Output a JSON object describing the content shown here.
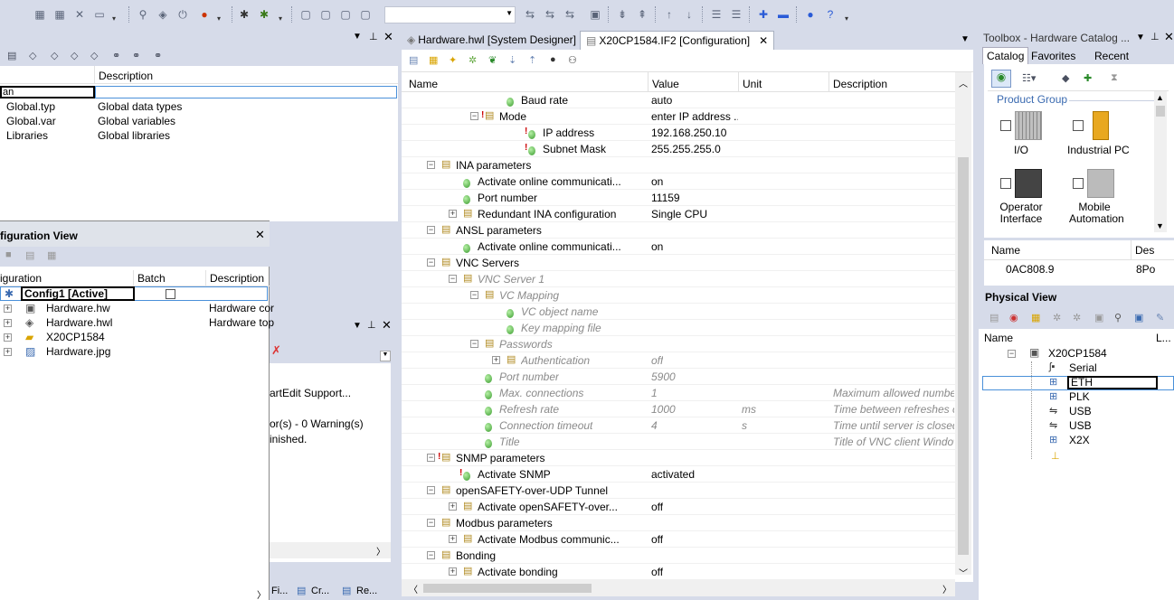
{
  "toolbar": {
    "icons": [
      "new-icon",
      "open-icon",
      "delete-icon",
      "save-icon",
      "find-icon",
      "build-icon",
      "power-icon",
      "traffic-light-icon",
      "debug-icon",
      "bug-icon",
      "window-icon",
      "find-replace-icon",
      "indent-icon",
      "arrow-up-icon",
      "arrow-down-icon",
      "list-icon",
      "help-icon"
    ]
  },
  "left_top": {
    "col_description": "Description",
    "edit_value": "an",
    "rows": [
      {
        "name": "Global.typ",
        "desc": "Global data types"
      },
      {
        "name": "Global.var",
        "desc": "Global variables"
      },
      {
        "name": "Libraries",
        "desc": "Global libraries"
      }
    ]
  },
  "config_view": {
    "title": "figuration View",
    "col_configuration": "iguration",
    "col_batch": "Batch",
    "col_description": "Description",
    "active_config": "Config1 [Active]",
    "items": [
      {
        "name": "Hardware.hw",
        "desc": "Hardware cor"
      },
      {
        "name": "Hardware.hwl",
        "desc": "Hardware top"
      },
      {
        "name": "X20CP1584",
        "desc": ""
      },
      {
        "name": "Hardware.jpg",
        "desc": ""
      }
    ]
  },
  "output": {
    "line1": "artEdit Support...",
    "line2": "or(s) - 0 Warning(s)",
    "line3": "inished.",
    "tabs": [
      "Fi...",
      "Cr...",
      "Re..."
    ]
  },
  "doc_tabs": {
    "tab1": "Hardware.hwl [System Designer]",
    "tab2": "X20CP1584.IF2 [Configuration]"
  },
  "config_grid": {
    "col_name": "Name",
    "col_value": "Value",
    "col_unit": "Unit",
    "col_description": "Description",
    "rows": [
      {
        "name": "Baud rate",
        "value": "auto",
        "unit": "",
        "desc": ""
      },
      {
        "name": "Mode",
        "value": "enter IP address ...",
        "unit": "",
        "desc": ""
      },
      {
        "name": "IP address",
        "value": "192.168.250.10",
        "unit": "",
        "desc": ""
      },
      {
        "name": "Subnet Mask",
        "value": "255.255.255.0",
        "unit": "",
        "desc": ""
      },
      {
        "name": "INA parameters",
        "value": "",
        "unit": "",
        "desc": ""
      },
      {
        "name": "Activate online communicati...",
        "value": "on",
        "unit": "",
        "desc": ""
      },
      {
        "name": "Port number",
        "value": "11159",
        "unit": "",
        "desc": ""
      },
      {
        "name": "Redundant INA configuration",
        "value": "Single CPU",
        "unit": "",
        "desc": ""
      },
      {
        "name": "ANSL parameters",
        "value": "",
        "unit": "",
        "desc": ""
      },
      {
        "name": "Activate online communicati...",
        "value": "on",
        "unit": "",
        "desc": ""
      },
      {
        "name": "VNC Servers",
        "value": "",
        "unit": "",
        "desc": ""
      },
      {
        "name": "VNC Server 1",
        "value": "",
        "unit": "",
        "desc": ""
      },
      {
        "name": "VC Mapping",
        "value": "",
        "unit": "",
        "desc": ""
      },
      {
        "name": "VC object name",
        "value": "",
        "unit": "",
        "desc": ""
      },
      {
        "name": "Key mapping file",
        "value": "",
        "unit": "",
        "desc": ""
      },
      {
        "name": "Passwords",
        "value": "",
        "unit": "",
        "desc": ""
      },
      {
        "name": "Authentication",
        "value": "off",
        "unit": "",
        "desc": ""
      },
      {
        "name": "Port number",
        "value": "5900",
        "unit": "",
        "desc": ""
      },
      {
        "name": "Max. connections",
        "value": "1",
        "unit": "",
        "desc": "Maximum allowed number of"
      },
      {
        "name": "Refresh rate",
        "value": "1000",
        "unit": "ms",
        "desc": "Time between refreshes of th"
      },
      {
        "name": "Connection timeout",
        "value": "4",
        "unit": "s",
        "desc": "Time until server is closed if"
      },
      {
        "name": "Title",
        "value": "",
        "unit": "",
        "desc": "Title of VNC client Window"
      },
      {
        "name": "SNMP parameters",
        "value": "",
        "unit": "",
        "desc": ""
      },
      {
        "name": "Activate SNMP",
        "value": "activated",
        "unit": "",
        "desc": ""
      },
      {
        "name": "openSAFETY-over-UDP Tunnel",
        "value": "",
        "unit": "",
        "desc": ""
      },
      {
        "name": "Activate openSAFETY-over...",
        "value": "off",
        "unit": "",
        "desc": ""
      },
      {
        "name": "Modbus parameters",
        "value": "",
        "unit": "",
        "desc": ""
      },
      {
        "name": "Activate Modbus communic...",
        "value": "off",
        "unit": "",
        "desc": ""
      },
      {
        "name": "Bonding",
        "value": "",
        "unit": "",
        "desc": ""
      },
      {
        "name": "Activate bonding",
        "value": "off",
        "unit": "",
        "desc": ""
      }
    ]
  },
  "toolbox": {
    "title": "Toolbox - Hardware Catalog ...",
    "tabs": [
      "Catalog",
      "Favorites",
      "Recent"
    ],
    "product_group": "Product Group",
    "items": [
      "I/O",
      "Industrial PC",
      "Operator Interface",
      "Mobile Automation"
    ],
    "col_name": "Name",
    "col_des": "Des",
    "row_name": "0AC808.9",
    "row_des": "8Po"
  },
  "physical_view": {
    "title": "Physical View",
    "col_name": "Name",
    "col_l": "L...",
    "root": "X20CP1584",
    "children": [
      "Serial",
      "ETH",
      "PLK",
      "USB",
      "USB",
      "X2X"
    ]
  }
}
